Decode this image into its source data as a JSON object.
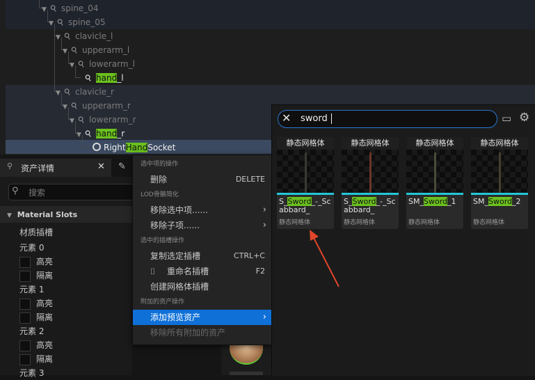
{
  "tree": {
    "rows": [
      {
        "label": "spine_04",
        "dim": true
      },
      {
        "label": "spine_05",
        "dim": true
      },
      {
        "label": "clavicle_l",
        "dim": true
      },
      {
        "label": "upperarm_l",
        "dim": true
      },
      {
        "label": "lowerarm_l",
        "dim": true
      },
      {
        "label_hl": "hand",
        "label_rest": "_l",
        "dim": false
      },
      {
        "label": "clavicle_r",
        "dim": true
      },
      {
        "label": "upperarm_r",
        "dim": true
      },
      {
        "label": "lowerarm_r",
        "dim": true
      },
      {
        "label_hl": "hand",
        "label_rest": "_r",
        "dim": false
      }
    ],
    "socket": {
      "pre": "Right",
      "hl": "Hand",
      "post": "Socket"
    }
  },
  "details": {
    "tab_label": "资产详情",
    "search_placeholder": "搜索",
    "section": "Material Slots",
    "slot_label": "材质插槽",
    "elements": [
      {
        "label": "元素 0",
        "opt1": "高亮",
        "opt2": "隔离"
      },
      {
        "label": "元素 1",
        "opt1": "高亮",
        "opt2": "隔离"
      },
      {
        "label": "元素 2",
        "opt1": "高亮",
        "opt2": "隔离"
      }
    ],
    "element3": "元素 3"
  },
  "context_menu": {
    "sections": {
      "selected": "选中项的操作",
      "lod": "LOD骨骼简化",
      "socket": "选中的插槽操作",
      "attached": "附加的资产操作"
    },
    "delete": "删除",
    "delete_shortcut": "DELETE",
    "remove_selected": "移除选中项......",
    "remove_children": "移除子项......",
    "copy_socket": "复制选定插槽",
    "copy_shortcut": "CTRL+C",
    "rename_socket": "重命名插槽",
    "rename_shortcut": "F2",
    "create_mesh_socket": "创建网格体插槽",
    "add_preview": "添加预览资产",
    "remove_all_attached": "移除所有附加的资产"
  },
  "picker": {
    "search_value": "sword",
    "assets": [
      {
        "type": "静态网格体",
        "name_pre": "S_",
        "name_hl": "Sword",
        "name_post": "_-_Scabbard_",
        "blade_color": "#3a3a34"
      },
      {
        "type": "静态网格体",
        "name_pre": "S_",
        "name_hl": "Sword",
        "name_post": "_-_Scabbard_",
        "blade_color": "#6a3626"
      },
      {
        "type": "静态网格体",
        "name_pre": "SM_",
        "name_hl": "Sword",
        "name_post": "_1",
        "blade_color": "#4a4a3a"
      },
      {
        "type": "静态网格体",
        "name_pre": "SM_",
        "name_hl": "Sword",
        "name_post": "_2",
        "blade_color": "#45402e"
      }
    ]
  },
  "colors": {
    "accent": "#0f70d8",
    "highlight": "#6bc11e",
    "asset_bar": "#24c6d8",
    "arrow": "#e0462a"
  }
}
